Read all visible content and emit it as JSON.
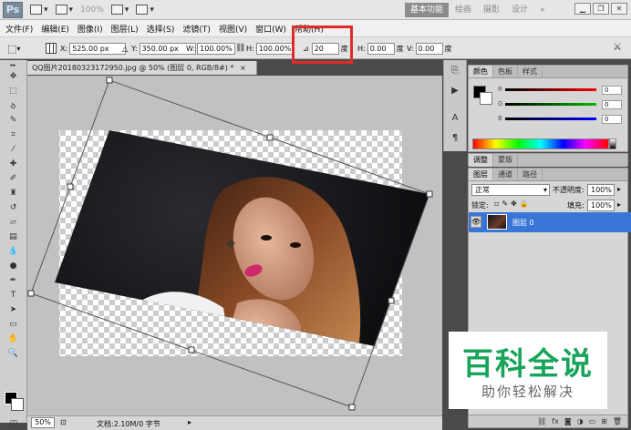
{
  "appbar": {
    "logo": "Ps",
    "zoom": "100%",
    "workspaces": [
      "基本功能",
      "绘画",
      "摄影",
      "设计",
      "»"
    ],
    "active_workspace": "基本功能"
  },
  "menu": [
    "文件(F)",
    "编辑(E)",
    "图像(I)",
    "图层(L)",
    "选择(S)",
    "滤镜(T)",
    "视图(V)",
    "窗口(W)",
    "帮助(H)"
  ],
  "options": {
    "x_label": "X:",
    "x_value": "525.00 px",
    "y_label": "Y:",
    "y_value": "350.00 px",
    "w_label": "W:",
    "w_value": "100.00%",
    "h_label": "H:",
    "h_value": "100.00%",
    "rotation_value": "20",
    "rotation_unit": "度",
    "hskew_label": "H:",
    "hskew_value": "0.00",
    "hskew_unit": "度",
    "vskew_label": "V:",
    "vskew_value": "0.00",
    "vskew_unit": "度"
  },
  "document": {
    "tab_title": "QQ图片20180323172950.jpg @ 50% (图层 0, RGB/8#) *",
    "zoom": "50%",
    "doc_info": "文档:2.10M/0 字节"
  },
  "color_panel": {
    "tabs": [
      "颜色",
      "色板",
      "样式"
    ],
    "r_label": "R",
    "r_value": "0",
    "g_label": "G",
    "g_value": "0",
    "b_label": "B",
    "b_value": "0",
    "colors": {
      "r": "#cc0000",
      "g": "#00aa00",
      "b": "#0000cc"
    }
  },
  "adjust_panel": {
    "tabs": [
      "调整",
      "蒙版"
    ]
  },
  "layers_panel": {
    "tabs": [
      "图层",
      "通道",
      "路径"
    ],
    "blend_mode": "正常",
    "opacity_label": "不透明度:",
    "opacity_value": "100%",
    "lock_label": "锁定:",
    "fill_label": "填充:",
    "fill_value": "100%",
    "layer_name": "图层 0"
  },
  "watermark": {
    "title": "百科全说",
    "subtitle": "助你轻松解决"
  }
}
